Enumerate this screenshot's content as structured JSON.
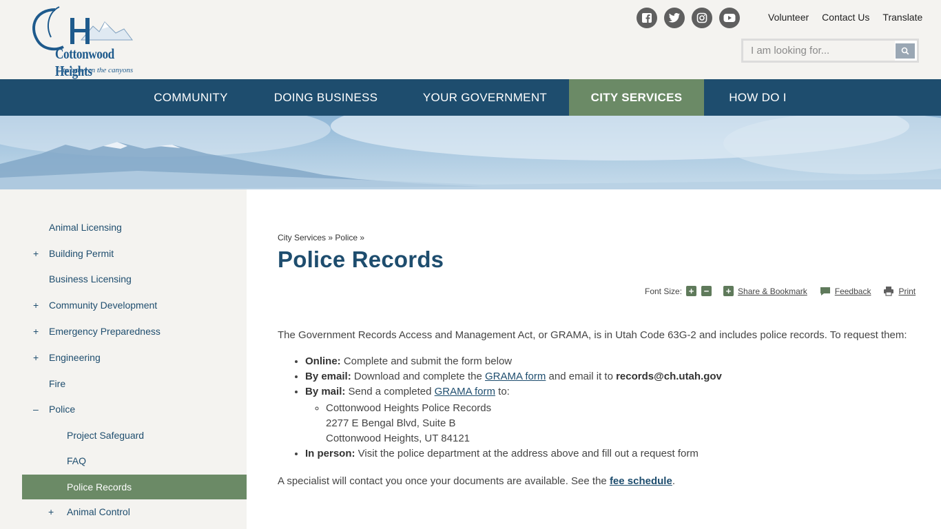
{
  "site": {
    "logo_name": "Cottonwood Heights",
    "logo_tagline": "City between the canyons"
  },
  "social": [
    "facebook-icon",
    "twitter-icon",
    "instagram-icon",
    "youtube-icon"
  ],
  "utility_links": [
    "Volunteer",
    "Contact Us",
    "Translate"
  ],
  "search": {
    "placeholder": "I am looking for..."
  },
  "nav": [
    {
      "label": "COMMUNITY"
    },
    {
      "label": "DOING BUSINESS"
    },
    {
      "label": "YOUR GOVERNMENT"
    },
    {
      "label": "CITY SERVICES",
      "active": true
    },
    {
      "label": "HOW DO I"
    }
  ],
  "sidebar": [
    {
      "label": "Animal Licensing",
      "toggle": ""
    },
    {
      "label": "Building Permit",
      "toggle": "+"
    },
    {
      "label": "Business Licensing",
      "toggle": ""
    },
    {
      "label": "Community Development",
      "toggle": "+"
    },
    {
      "label": "Emergency Preparedness",
      "toggle": "+"
    },
    {
      "label": "Engineering",
      "toggle": "+"
    },
    {
      "label": "Fire",
      "toggle": ""
    },
    {
      "label": "Police",
      "toggle": "–"
    },
    {
      "label": "Project Safeguard",
      "toggle": ""
    },
    {
      "label": "FAQ",
      "toggle": ""
    },
    {
      "label": "Police Records",
      "toggle": "",
      "active": true
    },
    {
      "label": "Animal Control",
      "toggle": "+"
    }
  ],
  "breadcrumb": {
    "part1": "City Services",
    "sep1": "»",
    "part2": "Police",
    "sep2": "»"
  },
  "page": {
    "title": "Police Records"
  },
  "tools": {
    "font_size_label": "Font Size:",
    "font_increase": "+",
    "font_decrease": "−",
    "share": "Share & Bookmark",
    "feedback": "Feedback",
    "print": "Print"
  },
  "content": {
    "intro": "The Government Records Access and Management Act, or GRAMA, is in Utah Code 63G-2 and includes police records. To request them:",
    "online_label": "Online:",
    "online_text": " Complete and submit the form below",
    "email_label": "By email:",
    "email_text1": " Download and complete the ",
    "email_link": "GRAMA form",
    "email_text2": " and email it to ",
    "email_address": "records@ch.utah.gov",
    "mail_label": "By mail:",
    "mail_text1": " Send a completed ",
    "mail_link": "GRAMA form",
    "mail_text2": " to:",
    "address_line1": "Cottonwood Heights Police Records",
    "address_line2": "2277 E Bengal Blvd, Suite B",
    "address_line3": "Cottonwood Heights, UT 84121",
    "inperson_label": "In person:",
    "inperson_text": " Visit the police department at the address above and fill out a request form",
    "closing_text": "A specialist will contact you once your documents are available. See the ",
    "closing_link": "fee schedule",
    "closing_end": "."
  }
}
